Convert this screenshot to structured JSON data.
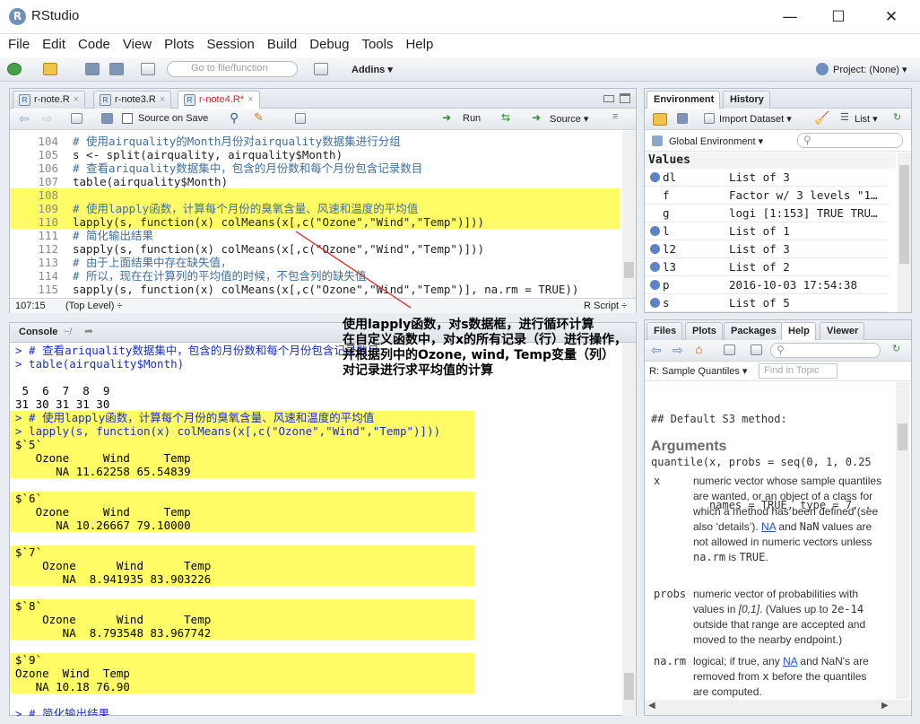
{
  "window": {
    "title": "RStudio",
    "app_icon": "R",
    "minimize": "—",
    "maximize": "☐",
    "close": "✕"
  },
  "menu": [
    "File",
    "Edit",
    "Code",
    "View",
    "Plots",
    "Session",
    "Build",
    "Debug",
    "Tools",
    "Help"
  ],
  "toolbar": {
    "goto_placeholder": "Go to file/function",
    "addins": "Addins ▾",
    "project": "Project: (None) ▾"
  },
  "editor": {
    "tabs": [
      {
        "label": "r-note.R"
      },
      {
        "label": "r-note3.R"
      },
      {
        "label": "r-note4.R*"
      }
    ],
    "close_glyph": "×",
    "source_on_save": "Source on Save",
    "run": "Run",
    "source": "Source ▾",
    "status_pos": "107:15",
    "status_scope": "(Top Level) ÷",
    "status_type": "R Script ÷"
  },
  "code": [
    {
      "n": "104",
      "t": "# 使用airquality的Month月份对airquality数据集进行分组",
      "k": "cm",
      "hl": false
    },
    {
      "n": "105",
      "t": "s <- split(airquality, airquality$Month)",
      "k": "",
      "hl": false
    },
    {
      "n": "106",
      "t": "# 查看ariquality数据集中，包含的月份数和每个月份包含记录数目",
      "k": "cm",
      "hl": false
    },
    {
      "n": "107",
      "t": "table(airquality$Month)",
      "k": "",
      "hl": false
    },
    {
      "n": "108",
      "t": "",
      "k": "",
      "hl": true
    },
    {
      "n": "109",
      "t": "# 使用lapply函数，计算每个月份的臭氧含量、风速和温度的平均值",
      "k": "cm",
      "hl": true
    },
    {
      "n": "110",
      "t": "lapply(s, function(x) colMeans(x[,c(\"Ozone\",\"Wind\",\"Temp\")]))",
      "k": "",
      "hl": true
    },
    {
      "n": "111",
      "t": "# 简化输出结果",
      "k": "cm",
      "hl": false
    },
    {
      "n": "112",
      "t": "sapply(s, function(x) colMeans(x[,c(\"Ozone\",\"Wind\",\"Temp\")]))",
      "k": "",
      "hl": false
    },
    {
      "n": "113",
      "t": "# 由于上面结果中存在缺失值，",
      "k": "cm",
      "hl": false
    },
    {
      "n": "114",
      "t": "# 所以，现在在计算列的平均值的时候，不包含列的缺失值",
      "k": "cm",
      "hl": false
    },
    {
      "n": "115",
      "t": "sapply(s, function(x) colMeans(x[,c(\"Ozone\",\"Wind\",\"Temp\")], na.rm = TRUE))",
      "k": "",
      "hl": false
    }
  ],
  "console": {
    "title": "Console",
    "path": "~/",
    "lines": [
      {
        "t": "> # 查看ariquality数据集中，包含的月份数和每个月份包含记录数目",
        "c": "#1a2fc8",
        "hl": false
      },
      {
        "t": "> table(airquality$Month)",
        "c": "#1a2fc8",
        "hl": false
      },
      {
        "t": "",
        "c": "#000",
        "hl": false
      },
      {
        "t": " 5  6  7  8  9",
        "c": "#000",
        "hl": false
      },
      {
        "t": "31 30 31 31 30",
        "c": "#000",
        "hl": false
      },
      {
        "t": "> # 使用lapply函数，计算每个月份的臭氧含量、风速和温度的平均值",
        "c": "#1a2fc8",
        "hl": true
      },
      {
        "t": "> lapply(s, function(x) colMeans(x[,c(\"Ozone\",\"Wind\",\"Temp\")]))",
        "c": "#1a2fc8",
        "hl": true
      },
      {
        "t": "$`5`",
        "c": "#000",
        "hl": true
      },
      {
        "t": "   Ozone     Wind     Temp",
        "c": "#000",
        "hl": true
      },
      {
        "t": "      NA 11.62258 65.54839",
        "c": "#000",
        "hl": true
      },
      {
        "t": "",
        "c": "#000",
        "hl": true
      },
      {
        "t": "$`6`",
        "c": "#000",
        "hl": true
      },
      {
        "t": "   Ozone     Wind     Temp",
        "c": "#000",
        "hl": true
      },
      {
        "t": "      NA 10.26667 79.10000",
        "c": "#000",
        "hl": true
      },
      {
        "t": "",
        "c": "#000",
        "hl": true
      },
      {
        "t": "$`7`",
        "c": "#000",
        "hl": true
      },
      {
        "t": "    Ozone      Wind      Temp",
        "c": "#000",
        "hl": true
      },
      {
        "t": "       NA  8.941935 83.903226",
        "c": "#000",
        "hl": true
      },
      {
        "t": "",
        "c": "#000",
        "hl": true
      },
      {
        "t": "$`8`",
        "c": "#000",
        "hl": true
      },
      {
        "t": "    Ozone      Wind      Temp",
        "c": "#000",
        "hl": true
      },
      {
        "t": "       NA  8.793548 83.967742",
        "c": "#000",
        "hl": true
      },
      {
        "t": "",
        "c": "#000",
        "hl": true
      },
      {
        "t": "$`9`",
        "c": "#000",
        "hl": true
      },
      {
        "t": "Ozone  Wind  Temp",
        "c": "#000",
        "hl": true
      },
      {
        "t": "   NA 10.18 76.90",
        "c": "#000",
        "hl": true
      },
      {
        "t": "",
        "c": "#000",
        "hl": false
      },
      {
        "t": "> # 简化输出结果",
        "c": "#1a2fc8",
        "hl": false
      }
    ]
  },
  "environment": {
    "tabs": [
      "Environment",
      "History"
    ],
    "import_dataset": "Import Dataset ▾",
    "list_view": "List ▾",
    "scope": "Global Environment ▾",
    "section": "Values",
    "rows": [
      {
        "name": "dl",
        "value": "List of 3",
        "dot": true
      },
      {
        "name": "f",
        "value": "Factor w/ 3 levels \"1…",
        "dot": false
      },
      {
        "name": "g",
        "value": "logi [1:153] TRUE TRU…",
        "dot": false
      },
      {
        "name": "l",
        "value": "List of 1",
        "dot": true
      },
      {
        "name": "l2",
        "value": "List of 3",
        "dot": true
      },
      {
        "name": "l3",
        "value": "List of 2",
        "dot": true
      },
      {
        "name": "p",
        "value": "2016-10-03 17:54:38",
        "dot": true
      },
      {
        "name": "s",
        "value": "List of 5",
        "dot": true
      }
    ]
  },
  "help": {
    "tabs": [
      "Files",
      "Plots",
      "Packages",
      "Help",
      "Viewer"
    ],
    "topic": "R: Sample Quantiles ▾",
    "find_placeholder": "Find in Topic",
    "usage1": "## Default S3 method:",
    "usage2": "quantile(x, probs = seq(0, 1, 0.25",
    "usage3": "         names = TRUE, type = 7, .",
    "heading": "Arguments",
    "arg_x": "x",
    "arg_x_a": "numeric vector whose sample quantiles are wanted, or an object of a class for which a method has been defined (see also ‘details’).",
    "arg_x_na": "NA",
    "arg_x_b": "and",
    "arg_x_nan": "NaN",
    "arg_x_c": "values are not allowed in numeric vectors unless",
    "arg_x_narm": "na.rm",
    "arg_x_d": "is",
    "arg_x_true": "TRUE",
    "arg_probs": "probs",
    "arg_probs_a": "numeric vector of probabilities with values in",
    "arg_probs_range": "[0,1]",
    "arg_probs_b": ". (Values up to",
    "arg_probs_e": "2e-14",
    "arg_probs_c": "outside that range are accepted and moved to the nearby endpoint.)",
    "arg_narm": "na.rm",
    "arg_narm_a": "logical; if true, any",
    "arg_narm_na": "NA",
    "arg_narm_b": "and NaN's are removed from",
    "arg_narm_x": "x",
    "arg_narm_c": "before the quantiles are computed."
  },
  "annotation": {
    "line1": "使用lapply函数，对s数据框，进行循环计算",
    "line2": "在自定义函数中，对x的所有记录（行）进行操作，",
    "line3": "并根据列中的Ozone, wind, Temp变量（列）",
    "line4": "对记录进行求平均值的计算"
  }
}
